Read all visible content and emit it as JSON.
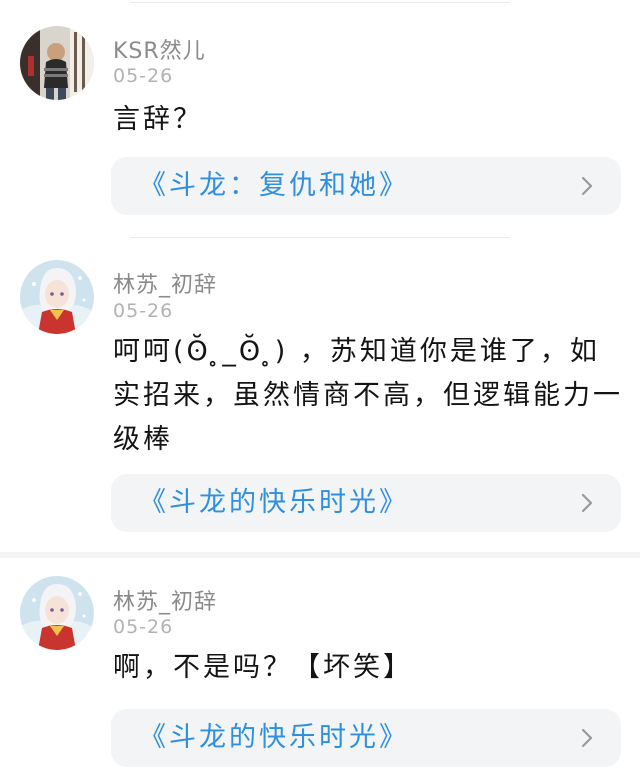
{
  "comments": [
    {
      "username": "KSR然儿",
      "date": "05-26",
      "text": "言辞？",
      "link": "《斗龙：复仇和她》",
      "avatar_icon": "child-photo-avatar"
    },
    {
      "username": "林苏_初辞",
      "date": "05-26",
      "text": "呵呵(ʘ̆ ̥_ʘ̆ ̥) ，苏知道你是谁了，如实招来，虽然情商不高，但逻辑能力一级棒",
      "link": "《斗龙的快乐时光》",
      "avatar_icon": "anime-character-avatar"
    },
    {
      "username": "林苏_初辞",
      "date": "05-26",
      "text": "啊，不是吗？【坏笑】",
      "link": "《斗龙的快乐时光》",
      "avatar_icon": "anime-character-avatar"
    }
  ],
  "colors": {
    "link": "#2f8fe0",
    "card_background": "#f3f4f6",
    "username": "#8a8a8a",
    "date": "#b2b2b2"
  }
}
